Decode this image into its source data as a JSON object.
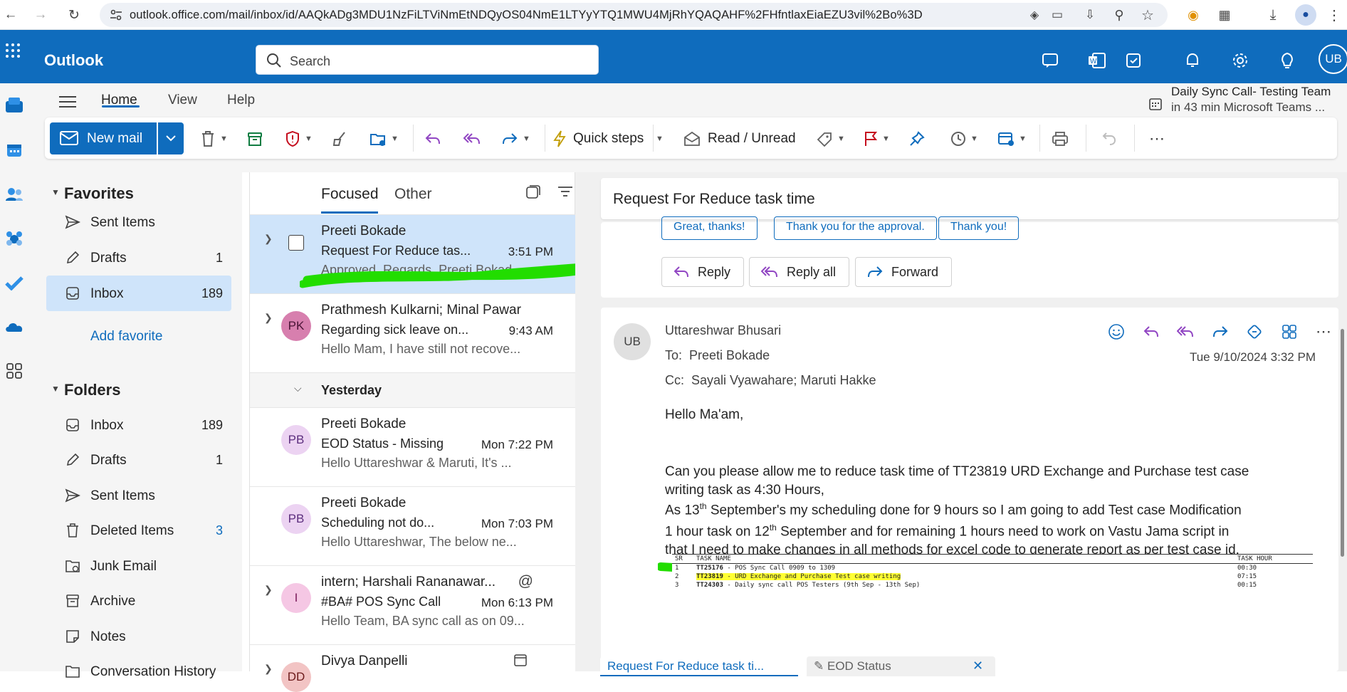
{
  "browser": {
    "url": "outlook.office.com/mail/inbox/id/AAQkADg3MDU1NzFiLTViNmEtNDQyOS04NmE1LTYyYTQ1MWU4MjRhYQAQAHF%2FHfntlaxEiaEZU3vil%2Bo%3D"
  },
  "header": {
    "app_name": "Outlook",
    "search_placeholder": "Search",
    "user_initials": "UB"
  },
  "ribbon": {
    "tabs": [
      "Home",
      "View",
      "Help"
    ],
    "active_tab": "Home",
    "new_mail_label": "New mail",
    "quick_steps_label": "Quick steps",
    "read_unread_label": "Read / Unread",
    "meeting": {
      "title": "Daily Sync Call- Testing Team",
      "detail": "in 43 min Microsoft Teams ..."
    }
  },
  "folders": {
    "favorites_label": "Favorites",
    "folders_label": "Folders",
    "add_favorite": "Add favorite",
    "favorites": [
      {
        "name": "Sent Items",
        "count": ""
      },
      {
        "name": "Drafts",
        "count": "1"
      },
      {
        "name": "Inbox",
        "count": "189"
      }
    ],
    "items": [
      {
        "name": "Inbox",
        "count": "189"
      },
      {
        "name": "Drafts",
        "count": "1"
      },
      {
        "name": "Sent Items",
        "count": ""
      },
      {
        "name": "Deleted Items",
        "count": "3"
      },
      {
        "name": "Junk Email",
        "count": ""
      },
      {
        "name": "Archive",
        "count": ""
      },
      {
        "name": "Notes",
        "count": ""
      },
      {
        "name": "Conversation History",
        "count": ""
      }
    ]
  },
  "list": {
    "tab_focused": "Focused",
    "tab_other": "Other",
    "group_yesterday": "Yesterday",
    "messages": [
      {
        "from": "Preeti Bokade",
        "subject": "Request For Reduce tas...",
        "time": "3:51 PM",
        "preview": "Approved. Regards, Preeti Bokad...",
        "initials": "",
        "avatar_color": "#ffffff"
      },
      {
        "from": "Prathmesh Kulkarni; Minal Pawar",
        "subject": "Regarding sick leave on...",
        "time": "9:43 AM",
        "preview": "Hello Mam, I have still not recove...",
        "initials": "PK",
        "avatar_color": "#d77fae"
      },
      {
        "from": "Preeti Bokade",
        "subject": "EOD Status - Missing",
        "time": "Mon 7:22 PM",
        "preview": "Hello Uttareshwar & Maruti, It's ...",
        "initials": "PB",
        "avatar_color": "#ecd3f2"
      },
      {
        "from": "Preeti Bokade",
        "subject": "Scheduling not do...",
        "time": "Mon 7:03 PM",
        "preview": "Hello Uttareshwar, The below ne...",
        "initials": "PB",
        "avatar_color": "#ecd3f2"
      },
      {
        "from": "intern; Harshali Rananawar...",
        "subject": "#BA# POS Sync Call",
        "time": "Mon 6:13 PM",
        "preview": "Hello Team, BA sync call as on 09...",
        "initials": "I",
        "avatar_color": "#f5c7e4"
      },
      {
        "from": "Divya Danpelli",
        "subject": "",
        "time": "",
        "preview": "",
        "initials": "DD",
        "avatar_color": "#f2c4c4"
      }
    ]
  },
  "reading": {
    "subject": "Request For Reduce task time",
    "suggested_replies": [
      "Great, thanks!",
      "Thank you for the approval.",
      "Thank you!"
    ],
    "reply_label": "Reply",
    "reply_all_label": "Reply all",
    "forward_label": "Forward",
    "sender": "Uttareshwar Bhusari",
    "sender_initials": "UB",
    "to_label": "To:",
    "to": "Preeti Bokade",
    "cc_label": "Cc:",
    "cc": "Sayali Vyawahare;   Maruti Hakke",
    "date": "Tue 9/10/2024 3:32 PM",
    "greeting": "Hello Ma'am,",
    "body_line1": "Can you please allow me to reduce task time of TT23819 URD Exchange and Purchase test case",
    "body_line2": "writing task as 4:30 Hours,",
    "body_line3a": "As 13",
    "body_line3b": "th",
    "body_line3c": " September's my scheduling done for 9 hours so I am going to add Test case Modification",
    "body_line4a": "1 hour task on 12",
    "body_line4b": "th",
    "body_line4c": " September  and for remaining 1 hours need  to work on Vastu Jama script in",
    "body_line5": "that I need to make changes in all methods for excel code to generate report as per test case id.",
    "table": {
      "headers": [
        "SR",
        "TASK NAME",
        "TASK HOUR"
      ],
      "rows": [
        {
          "sr": "1",
          "id": "TT25176",
          "name": " - POS Sync Call 0909 to 1309",
          "hour": "00:30"
        },
        {
          "sr": "2",
          "id": "TT23819",
          "name": " - URD Exchange and Purchase Test case writing",
          "hour": "07:15"
        },
        {
          "sr": "3",
          "id": "TT24303",
          "name": " - Daily sync call POS Testers (9th Sep - 13th Sep)",
          "hour": "00:15"
        }
      ]
    },
    "draft_tabs": [
      "Request For Reduce task ti...",
      "EOD Status"
    ]
  },
  "colors": {
    "brand": "#0f6cbd",
    "selection": "#cfe4fa",
    "annotation_green": "#22dd00",
    "highlight_yellow": "#ffff33"
  }
}
